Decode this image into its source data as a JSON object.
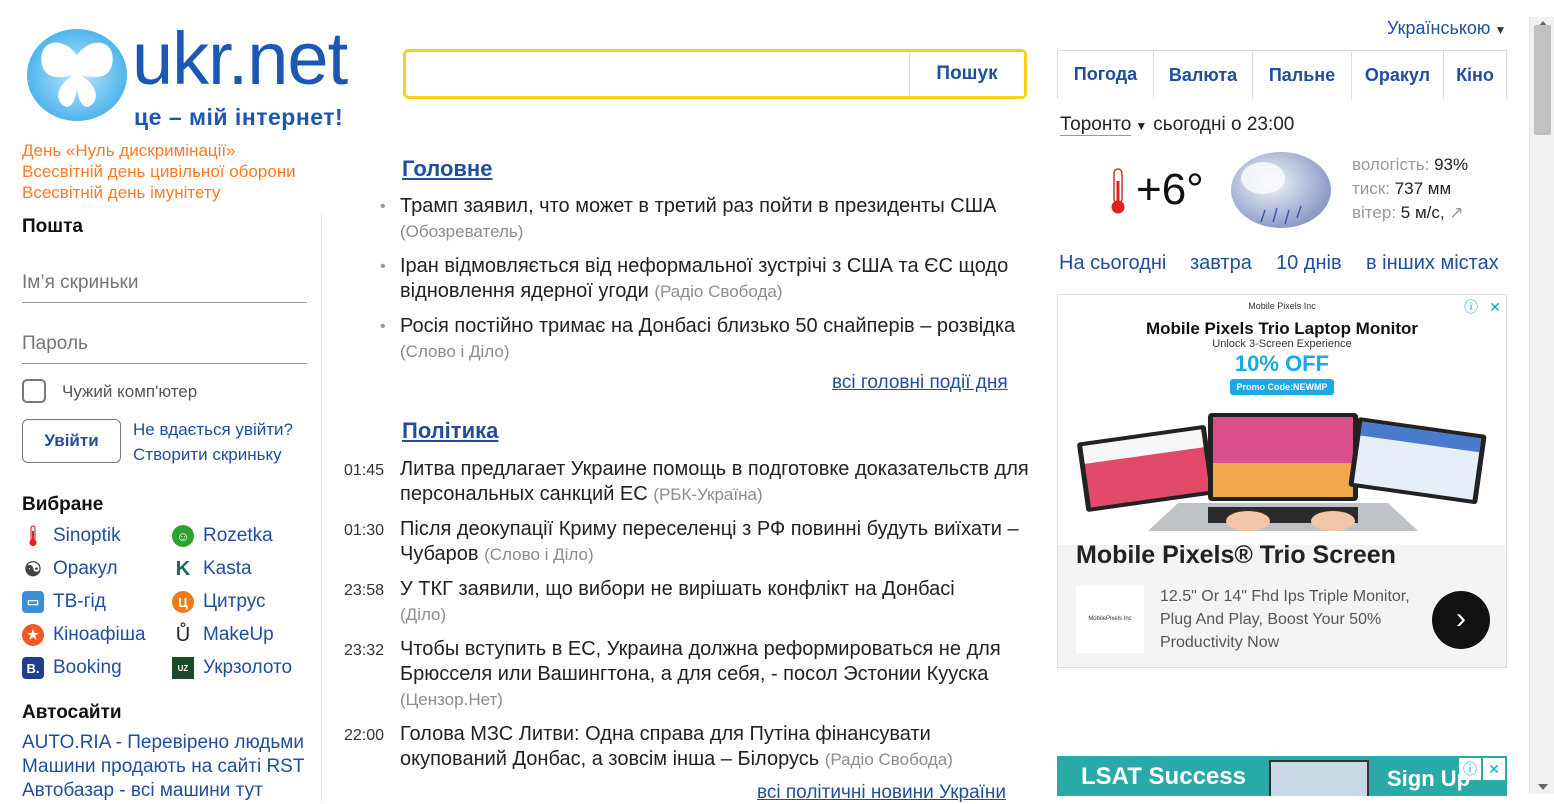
{
  "header": {
    "logo_text": "ukr.net",
    "logo_slogan": "це – мій інтернет!",
    "language": "Українською"
  },
  "holidays": [
    "День «Нуль дискримінації»",
    "Всесвітній день цивільної оборони",
    "Всесвітній день імунітету"
  ],
  "mail": {
    "title": "Пошта",
    "username_placeholder": "Ім’я скриньки",
    "password_placeholder": "Пароль",
    "foreign_computer_label": "Чужий комп'ютер",
    "login_label": "Увійти",
    "cant_login": "Не вдається увійти?",
    "create_box": "Створити скриньку"
  },
  "favorites": {
    "title": "Вибране",
    "items": [
      {
        "label": "Sinoptik",
        "icon": "thermometer-icon"
      },
      {
        "label": "Rozetka",
        "icon": "rozetka-smile-icon"
      },
      {
        "label": "Оракул",
        "icon": "yin-yang-icon"
      },
      {
        "label": "Kasta",
        "icon": "kasta-k-icon"
      },
      {
        "label": "ТВ-гід",
        "icon": "tv-icon"
      },
      {
        "label": "Цитрус",
        "icon": "citrus-icon"
      },
      {
        "label": "Кіноафіша",
        "icon": "star-icon"
      },
      {
        "label": "MakeUp",
        "icon": "makeup-u-icon"
      },
      {
        "label": "Booking",
        "icon": "booking-b-icon"
      },
      {
        "label": "Укрзолото",
        "icon": "ukrzoloto-icon"
      }
    ]
  },
  "autosites": {
    "title": "Автосайти",
    "lines": [
      "AUTO.RIA - Перевірено людьми",
      "Машини продають на сайті RST",
      "Автобазар - всі машини тут"
    ]
  },
  "search": {
    "button_label": "Пошук",
    "placeholder": ""
  },
  "news": {
    "main": {
      "title": "Головне",
      "items": [
        {
          "text": "Трамп заявил, что может в третий раз пойти в президенты США",
          "source": "(Обозреватель)"
        },
        {
          "text": "Іран відмовляється від неформальної зустрічі з США та ЄС щодо відновлення ядерної угоди",
          "source": "(Радіо Свобода)"
        },
        {
          "text": "Росія постійно тримає на Донбасі близько 50 снайперів – розвідка",
          "source": "(Слово і Діло)"
        }
      ],
      "more": "всі головні події дня"
    },
    "politics": {
      "title": "Політика",
      "items": [
        {
          "time": "01:45",
          "text": "Литва предлагает Украине помощь в подготовке доказательств для персональных санкций ЕС",
          "source": "(РБК-Україна)"
        },
        {
          "time": "01:30",
          "text": "Після деокупації Криму переселенці з РФ повинні будуть виїхати – Чубаров",
          "source": "(Слово і Діло)"
        },
        {
          "time": "23:58",
          "text": "У ТКГ заявили, що вибори не вирішать конфлікт на Донбасі",
          "source": "(Діло)"
        },
        {
          "time": "23:32",
          "text": "Чтобы вступить в ЕС, Украина должна реформироваться не для Брюсселя или Вашингтона, а для себя, - посол Эстонии Кууска",
          "source": "(Цензор.Нет)"
        },
        {
          "time": "22:00",
          "text": "Голова МЗС Литви: Одна справа для Путіна фінансувати окупований Донбас, а зовсім інша – Білорусь",
          "source": "(Радіо Свобода)"
        }
      ],
      "more": "всі політичні новини України"
    }
  },
  "widget": {
    "tabs": [
      "Погода",
      "Валюта",
      "Пальне",
      "Оракул",
      "Кіно"
    ],
    "active_tab": "Погода",
    "city": "Торонто",
    "when": "сьогодні о 23:00",
    "temperature": "+6°",
    "humidity_label": "вологість:",
    "humidity": "93%",
    "pressure_label": "тиск:",
    "pressure": "737 мм",
    "wind_label": "вітер:",
    "wind": "5 м/с,",
    "wind_arrow": "↗",
    "links": [
      "На сьогодні",
      "завтра",
      "10 днів",
      "в інших містах"
    ]
  },
  "ad": {
    "brand": "Mobile Pixels Inc",
    "title": "Mobile Pixels Trio Laptop Monitor",
    "subtitle": "Unlock 3-Screen Experience",
    "offer": "10% OFF",
    "promo": "Promo Code:NEWMP",
    "headline": "Mobile Pixels® Trio Screen",
    "logo_text": "MobilePixels Inc",
    "description": "12.5\" Or 14\" Fhd Ips Triple Monitor, Plug And Play, Boost Your 50% Productivity Now"
  },
  "ad2": {
    "left_text": "LSAT Success",
    "right_text": "Sign Up"
  },
  "colors": {
    "link": "#1f4e9c",
    "holiday": "#ff7a22",
    "search_border": "#f5d21a",
    "source_gray": "#8c8c8c"
  }
}
